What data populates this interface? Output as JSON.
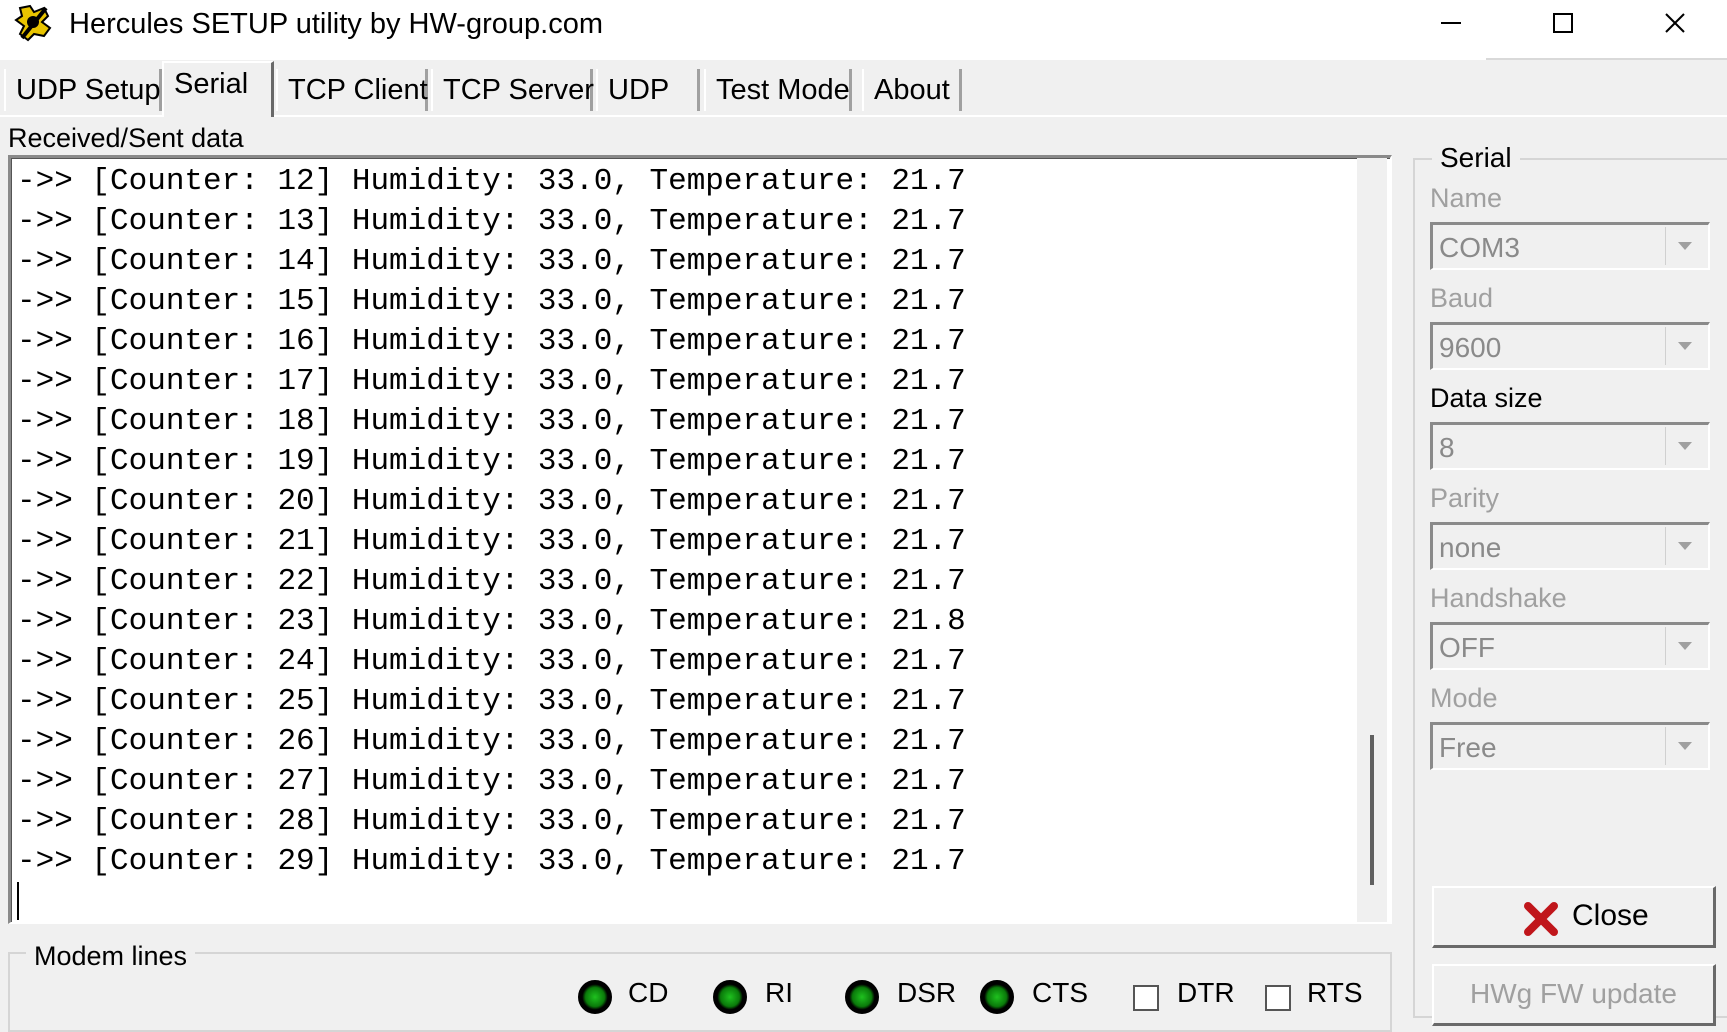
{
  "window": {
    "title": "Hercules SETUP utility by HW-group.com"
  },
  "tabs": [
    {
      "label": "UDP Setup",
      "active": false
    },
    {
      "label": "Serial",
      "active": true
    },
    {
      "label": "TCP Client",
      "active": false
    },
    {
      "label": "TCP Server",
      "active": false
    },
    {
      "label": "UDP",
      "active": false
    },
    {
      "label": "Test Mode",
      "active": false
    },
    {
      "label": "About",
      "active": false
    }
  ],
  "received": {
    "label": "Received/Sent data",
    "lines": [
      "->> [Counter: 12] Humidity: 33.0, Temperature: 21.7",
      "->> [Counter: 13] Humidity: 33.0, Temperature: 21.7",
      "->> [Counter: 14] Humidity: 33.0, Temperature: 21.7",
      "->> [Counter: 15] Humidity: 33.0, Temperature: 21.7",
      "->> [Counter: 16] Humidity: 33.0, Temperature: 21.7",
      "->> [Counter: 17] Humidity: 33.0, Temperature: 21.7",
      "->> [Counter: 18] Humidity: 33.0, Temperature: 21.7",
      "->> [Counter: 19] Humidity: 33.0, Temperature: 21.7",
      "->> [Counter: 20] Humidity: 33.0, Temperature: 21.7",
      "->> [Counter: 21] Humidity: 33.0, Temperature: 21.7",
      "->> [Counter: 22] Humidity: 33.0, Temperature: 21.7",
      "->> [Counter: 23] Humidity: 33.0, Temperature: 21.8",
      "->> [Counter: 24] Humidity: 33.0, Temperature: 21.7",
      "->> [Counter: 25] Humidity: 33.0, Temperature: 21.7",
      "->> [Counter: 26] Humidity: 33.0, Temperature: 21.7",
      "->> [Counter: 27] Humidity: 33.0, Temperature: 21.7",
      "->> [Counter: 28] Humidity: 33.0, Temperature: 21.7",
      "->> [Counter: 29] Humidity: 33.0, Temperature: 21.7"
    ]
  },
  "modem": {
    "legend": "Modem lines",
    "indicators": [
      {
        "label": "CD",
        "state": "on"
      },
      {
        "label": "RI",
        "state": "on"
      },
      {
        "label": "DSR",
        "state": "on"
      },
      {
        "label": "CTS",
        "state": "on"
      }
    ],
    "checkboxes": [
      {
        "label": "DTR",
        "checked": false
      },
      {
        "label": "RTS",
        "checked": false
      }
    ]
  },
  "serial": {
    "legend": "Serial",
    "fields": [
      {
        "label": "Name",
        "value": "COM3",
        "enabled": false
      },
      {
        "label": "Baud",
        "value": "9600",
        "enabled": false
      },
      {
        "label": "Data size",
        "value": "8",
        "enabled": true
      },
      {
        "label": "Parity",
        "value": "none",
        "enabled": false
      },
      {
        "label": "Handshake",
        "value": "OFF",
        "enabled": false
      },
      {
        "label": "Mode",
        "value": "Free",
        "enabled": false
      }
    ],
    "close_label": "Close",
    "fw_update_label": "HWg FW update"
  },
  "colors": {
    "background": "#f0f0f0",
    "led_on": "#1fc11f",
    "close_x": "#c0161b",
    "disabled_text": "#a0a0a0"
  }
}
